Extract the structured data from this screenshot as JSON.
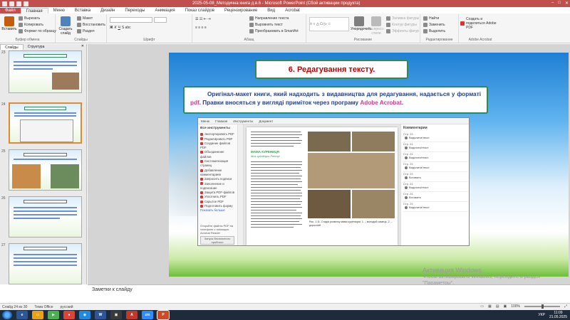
{
  "window": {
    "title": "2025-05-08_Методична книга д.в.6 - Microsoft PowerPoint (Сбой активации продукта)",
    "controls": [
      "–",
      "□",
      "✕"
    ]
  },
  "tabs": [
    "Файл",
    "Главная",
    "Меню",
    "Вставка",
    "Дизайн",
    "Переходы",
    "Анимация",
    "Показ слайдов",
    "Рецензирование",
    "Вид",
    "Acrobat"
  ],
  "ribbon": {
    "clipboard": {
      "paste": "Вставить",
      "cut": "Вырезать",
      "copy": "Копировать",
      "format": "Формат по образцу",
      "label": "Буфер обмена"
    },
    "slides": {
      "new": "Создать слайд",
      "layout": "Макет",
      "reset": "Восстановить",
      "section": "Раздел",
      "label": "Слайды"
    },
    "font": {
      "label": "Шрифт"
    },
    "paragraph": {
      "direction": "Направление текста",
      "align": "Выровнять текст",
      "smartart": "Преобразовать в SmartArt",
      "label": "Абзац"
    },
    "drawing": {
      "arrange": "Упорядочить",
      "styles": "Экспресс-стили",
      "fill": "Заливка фигуры",
      "outline": "Контур фигуры",
      "effects": "Эффекты фигур",
      "label": "Рисование"
    },
    "editing": {
      "find": "Найти",
      "replace": "Заменить",
      "select": "Выделить",
      "label": "Редактирование"
    },
    "acrobat": {
      "create": "Создать и поделиться Adobe PDF",
      "label": "Adobe Acrobat"
    }
  },
  "leftpane": {
    "tab_slides": "Слайды",
    "tab_outline": "Структура",
    "close": "✕",
    "slides": [
      {
        "num": "23"
      },
      {
        "num": "24"
      },
      {
        "num": "25"
      },
      {
        "num": "26"
      },
      {
        "num": "27"
      }
    ]
  },
  "slide": {
    "title": "6. Редагування тексту.",
    "body_pre": "Оригінал-макет книги, який надходить з видавництва для редагування, надається у форматі ",
    "body_pdf": "pdf",
    "body_mid": ". Правки вносяться у вигляді приміток через програму ",
    "body_adobe": "Adobe Acrobat",
    "body_end": "."
  },
  "acrobat": {
    "menu": [
      "Меню",
      "Главная",
      "Инструменты",
      "Документ"
    ],
    "tools_header": "Все инструменты",
    "tools": [
      "Экспортировать PDF",
      "Редактировать PDF",
      "Создание файлов PDF",
      "Объединение файлов",
      "Систематизация страниц",
      "Добавление комментариев",
      "Запросить подписи",
      "Заполнение и подписание",
      "Защита PDF-файлов",
      "Уплотнить PDF",
      "Скрытое PDF",
      "Подготовить форму",
      "Показать больше"
    ],
    "trial_note": "Откройте файлы PDF на телефоне с помощью Acrobat Reader",
    "trial_btn": "Запуск бесплатного пробного",
    "page_heading": "МАМА КУРЕНИЦЯ",
    "page_subheading": "Mus spicilegus Petenyi",
    "comments_header": "Комментарии",
    "comments": [
      {
        "page": "Стр. 24",
        "text": "Видалити/текст"
      },
      {
        "page": "Стр. 24",
        "text": "Виділити/текст"
      },
      {
        "page": "Стр. 24",
        "text": "Виділити/текст"
      },
      {
        "page": "Стр. 24",
        "text": "Видалити/текст"
      },
      {
        "page": "Стр. 24",
        "text": "Вставить"
      },
      {
        "page": "Стр. 24",
        "text": "Виділити/текст"
      },
      {
        "page": "Стр. 24",
        "text": "Вставить"
      },
      {
        "page": "Стр. 24",
        "text": "Видалити/текст"
      }
    ],
    "caption": "Рис. 1.11. Стадія розвитку мами куреницяи. 1. – молодий самець, 2. – дорослий"
  },
  "activation": {
    "line1": "Активация Windows",
    "line2": "Чтобы активировать Windows, перейдите в раздел \"Параметры\"."
  },
  "notes": {
    "placeholder": "Заметки к слайду"
  },
  "status": {
    "slide": "Слайд 24 из 30",
    "theme": "Тема Office",
    "lang": "русский",
    "zoom": "100%"
  },
  "taskbar": {
    "lang": "УКР",
    "time": "11:09",
    "date": "21.05.2025"
  },
  "colors": {
    "title_red": "#c00000",
    "body_blue": "#1f3f99",
    "highlight_pink": "#e0338a",
    "border_green": "#2e8b57",
    "ppt_red": "#c0504d"
  }
}
